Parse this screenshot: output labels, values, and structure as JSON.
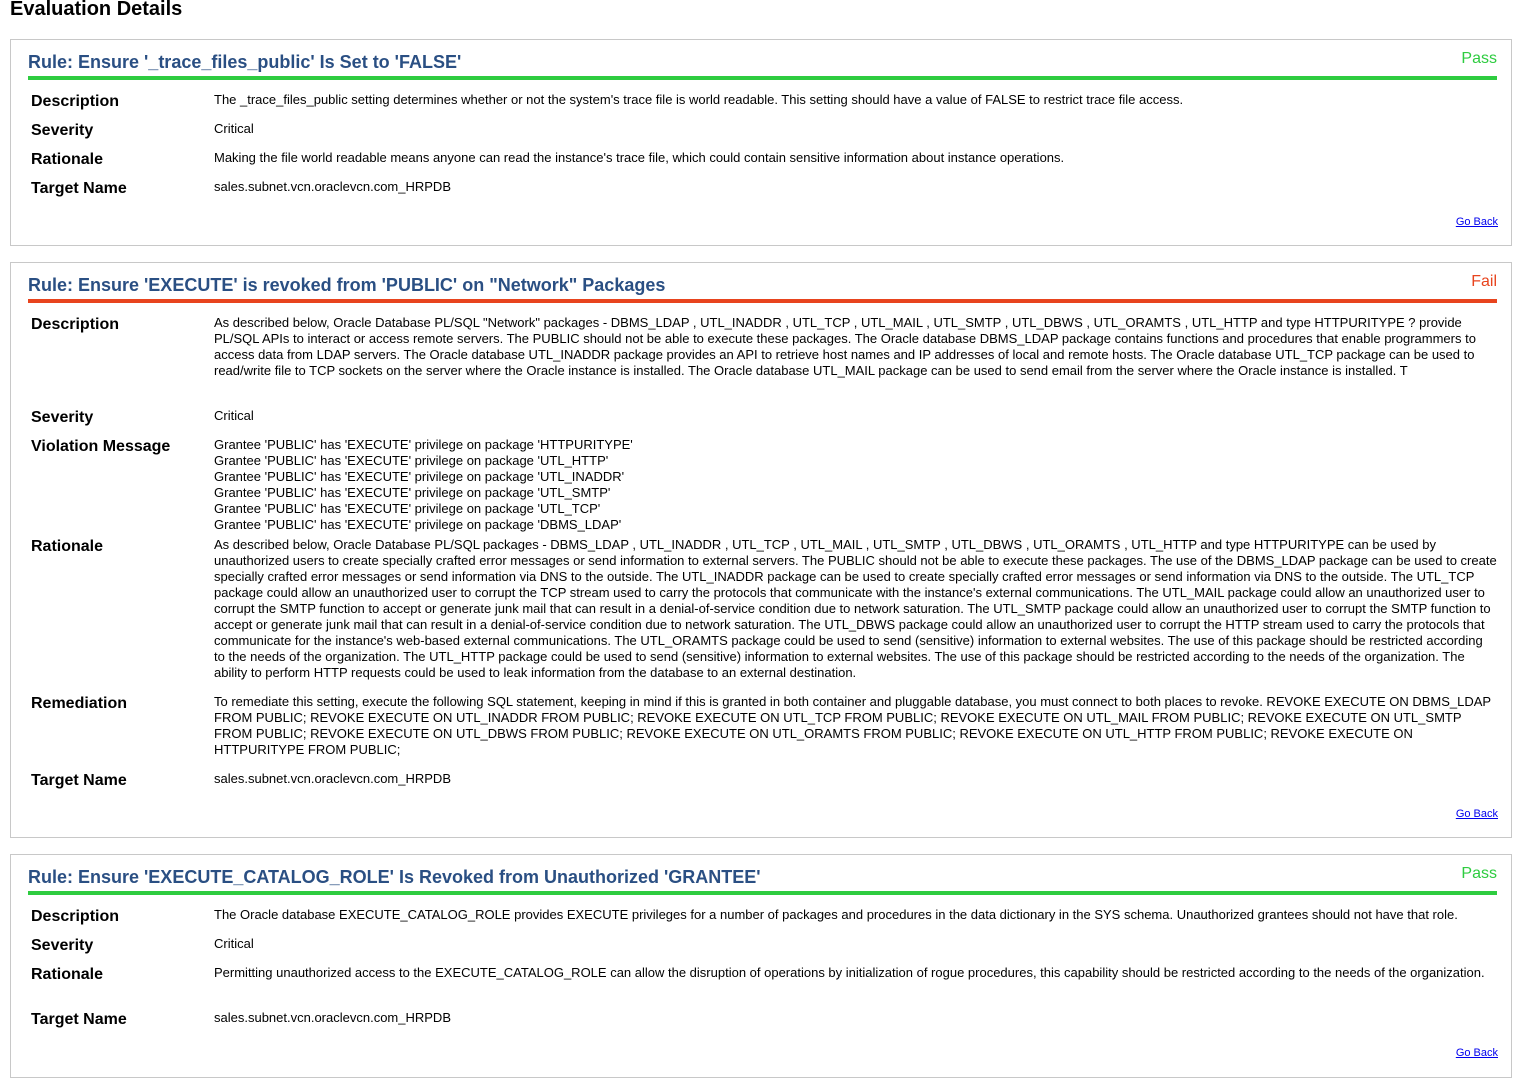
{
  "page": {
    "title": "Evaluation Details"
  },
  "labels": {
    "description": "Description",
    "severity": "Severity",
    "violation_message": "Violation Message",
    "rationale": "Rationale",
    "remediation": "Remediation",
    "target_name": "Target Name",
    "go_back": "Go Back"
  },
  "colors": {
    "pass": "#2ecc40",
    "fail": "#e8441e",
    "title": "#2a4f83",
    "link": "#0000ee"
  },
  "rules": [
    {
      "title": "Rule: Ensure '_trace_files_public' Is Set to 'FALSE'",
      "status": "Pass",
      "description": "The _trace_files_public setting determines whether or not the system's trace file is world readable. This setting should have a value of FALSE to restrict trace file access.",
      "severity": "Critical",
      "rationale": "Making the file world readable means anyone can read the instance's trace file, which could contain sensitive information about instance operations.",
      "target_name": "sales.subnet.vcn.oraclevcn.com_HRPDB"
    },
    {
      "title": "Rule: Ensure 'EXECUTE' is revoked from 'PUBLIC' on \"Network\" Packages",
      "status": "Fail",
      "description": "As described below, Oracle Database PL/SQL \"Network\" packages - DBMS_LDAP , UTL_INADDR , UTL_TCP , UTL_MAIL , UTL_SMTP , UTL_DBWS , UTL_ORAMTS , UTL_HTTP and type HTTPURITYPE ? provide PL/SQL APIs to interact or access remote servers. The PUBLIC should not be able to execute these packages. The Oracle database DBMS_LDAP package contains functions and procedures that enable programmers to access data from LDAP servers. The Oracle database UTL_INADDR package provides an API to retrieve host names and IP addresses of local and remote hosts. The Oracle database UTL_TCP package can be used to read/write file to TCP sockets on the server where the Oracle instance is installed. The Oracle database UTL_MAIL package can be used to send email from the server where the Oracle instance is installed. T",
      "severity": "Critical",
      "violation_messages": [
        "Grantee 'PUBLIC' has 'EXECUTE' privilege on package 'HTTPURITYPE'",
        "Grantee 'PUBLIC' has 'EXECUTE' privilege on package 'UTL_HTTP'",
        "Grantee 'PUBLIC' has 'EXECUTE' privilege on package 'UTL_INADDR'",
        "Grantee 'PUBLIC' has 'EXECUTE' privilege on package 'UTL_SMTP'",
        "Grantee 'PUBLIC' has 'EXECUTE' privilege on package 'UTL_TCP'",
        "Grantee 'PUBLIC' has 'EXECUTE' privilege on package 'DBMS_LDAP'"
      ],
      "rationale": "As described below, Oracle Database PL/SQL packages - DBMS_LDAP , UTL_INADDR , UTL_TCP , UTL_MAIL , UTL_SMTP , UTL_DBWS , UTL_ORAMTS , UTL_HTTP and type HTTPURITYPE can be used by unauthorized users to create specially crafted error messages or send information to external servers. The PUBLIC should not be able to execute these packages. The use of the DBMS_LDAP package can be used to create specially crafted error messages or send information via DNS to the outside. The UTL_INADDR package can be used to create specially crafted error messages or send information via DNS to the outside. The UTL_TCP package could allow an unauthorized user to corrupt the TCP stream used to carry the protocols that communicate with the instance's external communications. The UTL_MAIL package could allow an unauthorized user to corrupt the SMTP function to accept or generate junk mail that can result in a denial-of-service condition due to network saturation. The UTL_SMTP package could allow an unauthorized user to corrupt the SMTP function to accept or generate junk mail that can result in a denial-of-service condition due to network saturation. The UTL_DBWS package could allow an unauthorized user to corrupt the HTTP stream used to carry the protocols that communicate for the instance's web-based external communications. The UTL_ORAMTS package could be used to send (sensitive) information to external websites. The use of this package should be restricted according to the needs of the organization. The UTL_HTTP package could be used to send (sensitive) information to external websites. The use of this package should be restricted according to the needs of the organization. The ability to perform HTTP requests could be used to leak information from the database to an external destination.",
      "remediation": "To remediate this setting, execute the following SQL statement, keeping in mind if this is granted in both container and pluggable database, you must connect to both places to revoke. REVOKE EXECUTE ON DBMS_LDAP FROM PUBLIC; REVOKE EXECUTE ON UTL_INADDR FROM PUBLIC; REVOKE EXECUTE ON UTL_TCP FROM PUBLIC; REVOKE EXECUTE ON UTL_MAIL FROM PUBLIC; REVOKE EXECUTE ON UTL_SMTP FROM PUBLIC; REVOKE EXECUTE ON UTL_DBWS FROM PUBLIC; REVOKE EXECUTE ON UTL_ORAMTS FROM PUBLIC; REVOKE EXECUTE ON UTL_HTTP FROM PUBLIC; REVOKE EXECUTE ON HTTPURITYPE FROM PUBLIC;",
      "target_name": "sales.subnet.vcn.oraclevcn.com_HRPDB"
    },
    {
      "title": "Rule: Ensure 'EXECUTE_CATALOG_ROLE' Is Revoked from Unauthorized 'GRANTEE'",
      "status": "Pass",
      "description": "The Oracle database EXECUTE_CATALOG_ROLE provides EXECUTE privileges for a number of packages and procedures in the data dictionary in the SYS schema. Unauthorized grantees should not have that role.",
      "severity": "Critical",
      "rationale": "Permitting unauthorized access to the EXECUTE_CATALOG_ROLE can allow the disruption of operations by initialization of rogue procedures, this capability should be restricted according to the needs of the organization.",
      "target_name": "sales.subnet.vcn.oraclevcn.com_HRPDB"
    }
  ]
}
